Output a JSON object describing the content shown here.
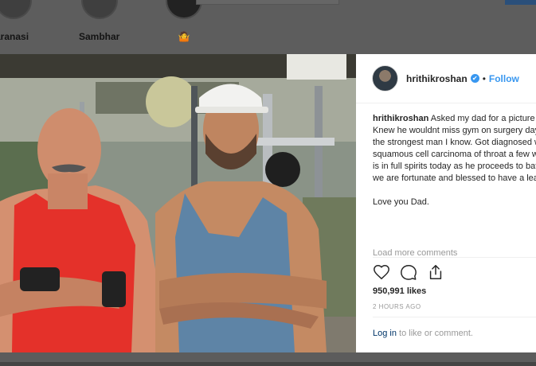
{
  "stories": [
    {
      "label": "aranasi"
    },
    {
      "label": "Sambhar"
    },
    {
      "label": "🤷"
    }
  ],
  "post": {
    "username": "hrithikroshan",
    "verified_mark": "✔",
    "separator": "•",
    "follow_label": "Follow",
    "caption_user": "hrithikroshan",
    "caption_text": " Asked my dad for a picture this morning. Knew he wouldnt miss gym on surgery day. He is probably the strongest man I know. Got diagnosed with early stage squamous cell carcinoma of throat a few weeks ago, but he is in full spirits today as he proceeds to battle it. As a family we are fortunate and blessed to have a leader like him. .",
    "caption_closing": "Love you Dad.",
    "load_more": "Load more comments",
    "likes": "950,991 likes",
    "time": "2 HOURS AGO",
    "login_link": "Log in",
    "login_rest": " to like or comment."
  },
  "icons": {
    "like": "heart-icon",
    "comment": "comment-icon",
    "share": "share-icon",
    "verified": "verified-badge-icon"
  },
  "colors": {
    "accent": "#3897f0",
    "text": "#262626",
    "muted": "#999999"
  }
}
